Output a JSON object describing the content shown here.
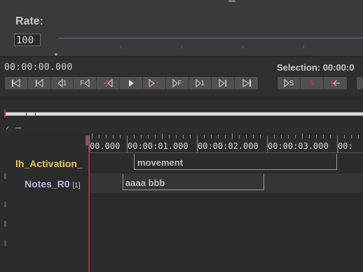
{
  "controls": {
    "rate_label": "Rate:",
    "rate_value": "100"
  },
  "media": {
    "time": "00:00:00.000",
    "selection_label": "Selection: 00:00:0",
    "transport_buttons": [
      {
        "name": "go-to-begin",
        "label": ""
      },
      {
        "name": "previous-frame",
        "label": ""
      },
      {
        "name": "step-back-1",
        "label": "1"
      },
      {
        "name": "frame-back",
        "label": "F"
      },
      {
        "name": "previous-boundary",
        "label": "-"
      },
      {
        "name": "play",
        "label": ""
      },
      {
        "name": "play-selection",
        "label": "+"
      },
      {
        "name": "frame-forward",
        "label": "F"
      },
      {
        "name": "step-forward-1",
        "label": "1"
      },
      {
        "name": "next-frame",
        "label": ""
      },
      {
        "name": "go-to-end",
        "label": ""
      }
    ],
    "selection_buttons": [
      {
        "name": "play-selection-s",
        "label": "S"
      },
      {
        "name": "clear-selection-s",
        "label": "S"
      },
      {
        "name": "selection-left",
        "label": ""
      }
    ]
  },
  "ruler": {
    "labels": [
      "00.000",
      "00:00:01.000",
      "00:00:02.000",
      "00:00:03.000",
      "00:"
    ]
  },
  "tiers": [
    {
      "name": "lh_Activation_",
      "sub": "",
      "active": true
    },
    {
      "name": "Notes_R0",
      "sub": "[1]",
      "active": false
    }
  ],
  "annotations": [
    {
      "tier": 0,
      "text": "movement"
    },
    {
      "tier": 1,
      "text": "aaaa bbb"
    }
  ],
  "colors": {
    "active_tier": "#e8c85a",
    "tier_name": "#b8b8e8",
    "cursor": "#b0244a"
  }
}
